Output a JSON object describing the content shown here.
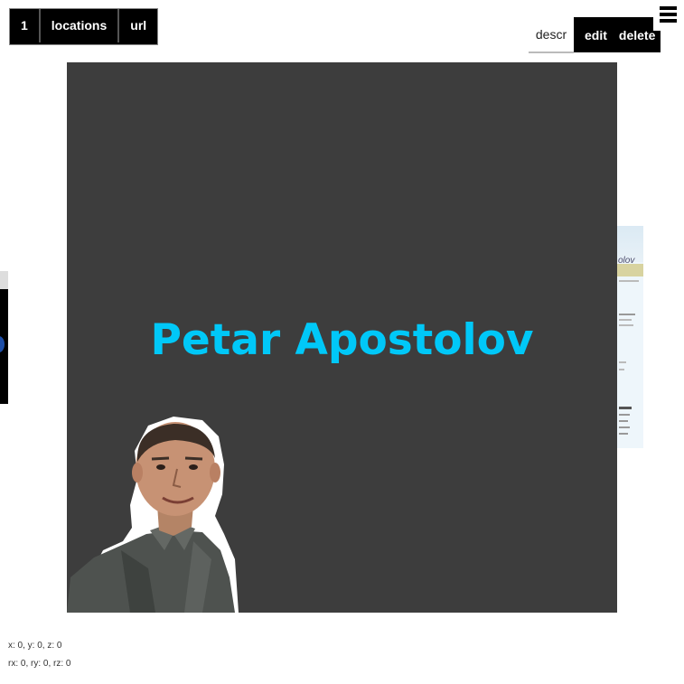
{
  "nav": {
    "tabs": [
      {
        "label": "1"
      },
      {
        "label": "locations"
      },
      {
        "label": "url"
      }
    ]
  },
  "actions": {
    "descr_label": "descr",
    "edit_label": "edit",
    "delete_label": "delete",
    "menu_icon": "hamburger-menu-icon"
  },
  "card": {
    "title": "Petar Apostolov",
    "title_color": "#00c8f8",
    "background": "#3d3d3d"
  },
  "background_page": {
    "name_fragment": "olov"
  },
  "readouts": {
    "position": "x: 0, y: 0, z: 0",
    "rotation": "rx: 0, ry: 0, rz: 0"
  }
}
